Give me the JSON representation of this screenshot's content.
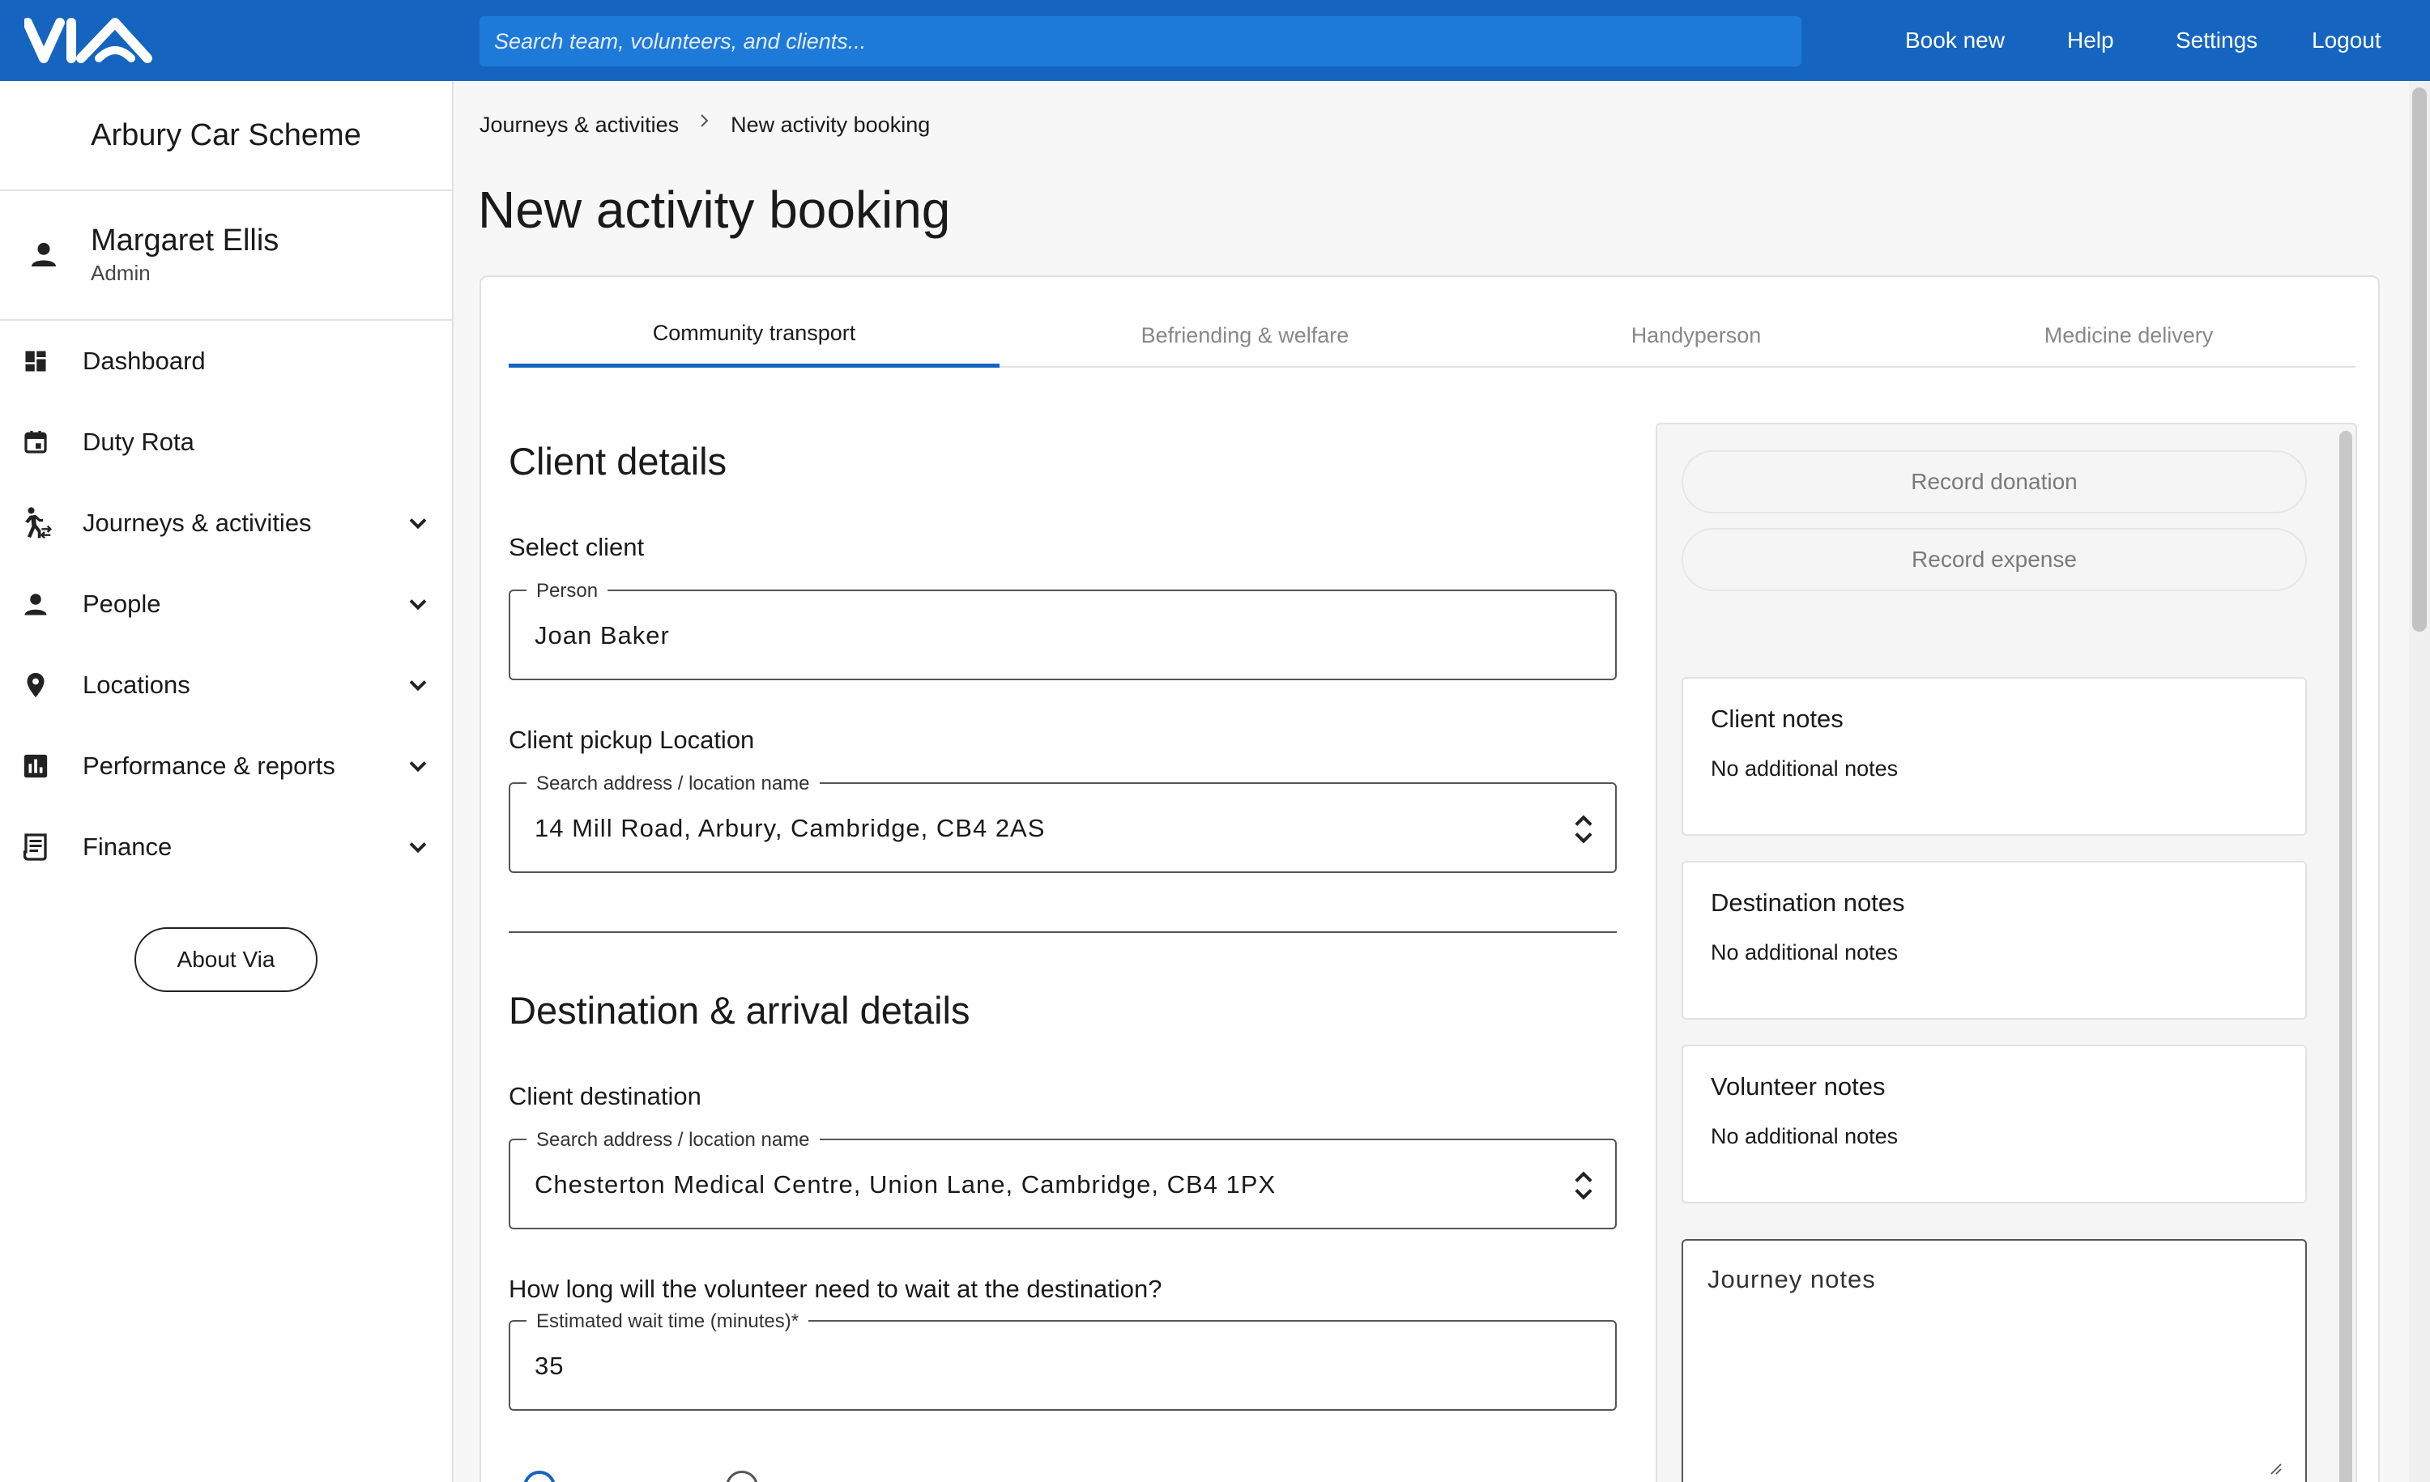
{
  "app": {
    "logo_label": "VIA"
  },
  "search": {
    "placeholder": "Search team, volunteers, and clients..."
  },
  "topnav": {
    "book_new": "Book new",
    "help": "Help",
    "settings": "Settings",
    "logout": "Logout"
  },
  "sidebar": {
    "org_name": "Arbury Car Scheme",
    "user": {
      "name": "Margaret Ellis",
      "role": "Admin"
    },
    "items": [
      {
        "label": "Dashboard",
        "icon": "dashboard-icon",
        "expandable": false
      },
      {
        "label": "Duty Rota",
        "icon": "calendar-icon",
        "expandable": false
      },
      {
        "label": "Journeys & activities",
        "icon": "walking-person-icon",
        "expandable": true
      },
      {
        "label": "People",
        "icon": "person-icon",
        "expandable": true
      },
      {
        "label": "Locations",
        "icon": "location-pin-icon",
        "expandable": true
      },
      {
        "label": "Performance & reports",
        "icon": "bar-chart-icon",
        "expandable": true
      },
      {
        "label": "Finance",
        "icon": "receipt-icon",
        "expandable": true
      }
    ],
    "about_label": "About Via"
  },
  "breadcrumb": {
    "parent": "Journeys & activities",
    "current": "New activity booking"
  },
  "page_title": "New activity booking",
  "tabs": [
    {
      "label": "Community transport",
      "active": true
    },
    {
      "label": "Befriending & welfare",
      "active": false
    },
    {
      "label": "Handyperson",
      "active": false
    },
    {
      "label": "Medicine delivery",
      "active": false
    }
  ],
  "client_details": {
    "heading": "Client details",
    "select_client_label": "Select client",
    "person_legend": "Person",
    "person_value": "Joan Baker",
    "pickup_label": "Client pickup Location",
    "pickup_legend": "Search address / location name",
    "pickup_value": "14 Mill Road, Arbury, Cambridge, CB4 2AS"
  },
  "destination": {
    "heading": "Destination & arrival details",
    "dest_label": "Client destination",
    "dest_legend": "Search address / location name",
    "dest_value": "Chesterton Medical Centre, Union Lane, Cambridge, CB4 1PX",
    "wait_question": "How long will the volunteer need to wait at the destination?",
    "wait_legend": "Estimated wait time (minutes)*",
    "wait_value": "35"
  },
  "right_panel": {
    "record_donation": "Record donation",
    "record_expense": "Record expense",
    "notes": [
      {
        "title": "Client notes",
        "body": "No additional notes"
      },
      {
        "title": "Destination notes",
        "body": "No additional notes"
      },
      {
        "title": "Volunteer notes",
        "body": "No additional notes"
      }
    ],
    "journey_notes_placeholder": "Journey notes"
  },
  "colors": {
    "brand": "#1565c0",
    "search_bg": "#1e7ad9",
    "tab_active": "#1565c0"
  }
}
